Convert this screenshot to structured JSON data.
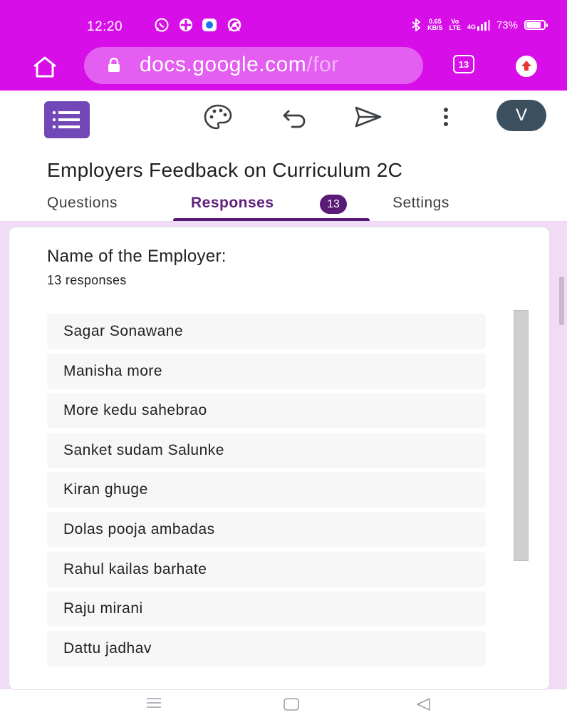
{
  "status_bar": {
    "time": "12:20",
    "net_speed_top": "0.65",
    "net_speed_bottom": "KB/S",
    "volte_top": "Vo",
    "volte_bottom": "LTE",
    "network": "4G",
    "battery": "73%"
  },
  "browser": {
    "url_host": "docs.google.com",
    "url_path": "/for",
    "tab_count": "13"
  },
  "toolbar": {
    "avatar_initial": "V"
  },
  "form": {
    "title": "Employers Feedback on Curriculum 2C"
  },
  "tabs": {
    "questions": "Questions",
    "responses": "Responses",
    "responses_badge": "13",
    "settings": "Settings"
  },
  "question": {
    "title": "Name of the Employer:",
    "response_count": "13 responses",
    "responses": [
      "Sagar Sonawane",
      "Manisha more",
      "More kedu sahebrao",
      "Sanket sudam Salunke",
      "Kiran ghuge",
      "Dolas pooja ambadas",
      "Rahul kailas barhate",
      "Raju mirani",
      "Dattu jadhav"
    ]
  },
  "colors": {
    "browser_bar": "#d70ee8",
    "accent_purple": "#5a1a78",
    "content_bg": "#f0dcf7",
    "avatar_bg": "#3b4f5e"
  }
}
